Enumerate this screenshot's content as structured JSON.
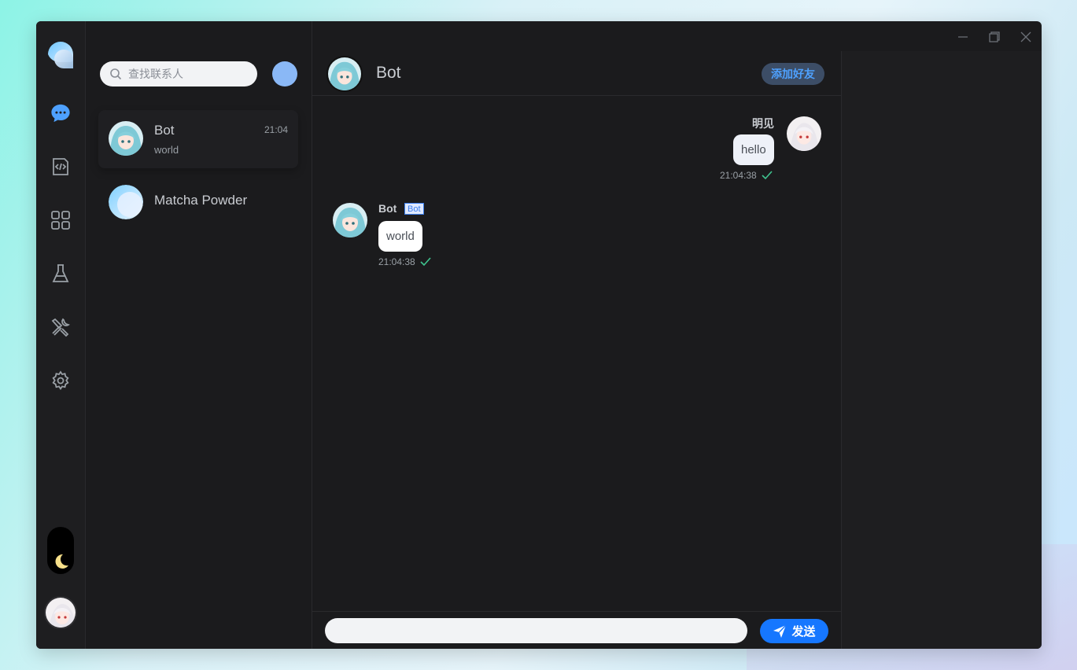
{
  "search": {
    "placeholder": "查找联系人"
  },
  "contacts": [
    {
      "name": "Bot",
      "preview": "world",
      "time": "21:04"
    },
    {
      "name": "Matcha Powder",
      "preview": "",
      "time": ""
    }
  ],
  "chat": {
    "title": "Bot",
    "add_friend_label": "添加好友",
    "messages": [
      {
        "sender": "明见",
        "text": "hello",
        "time": "21:04:38",
        "side": "right"
      },
      {
        "sender": "Bot",
        "tag": "Bot",
        "text": "world",
        "time": "21:04:38",
        "side": "left"
      }
    ],
    "input_value": "",
    "send_label": "发送"
  },
  "icons": [
    "app-logo-icon",
    "chat-icon",
    "code-icon",
    "apps-icon",
    "flask-icon",
    "tools-icon",
    "settings-icon",
    "moon-icon",
    "search-icon",
    "send-icon",
    "check-icon",
    "minimize-icon",
    "restore-icon",
    "close-icon"
  ],
  "colors": {
    "accent": "#1677ff",
    "nav_active": "#4ea1ff",
    "add_friend_bg": "#3c4d66",
    "check": "#3fc48f"
  }
}
